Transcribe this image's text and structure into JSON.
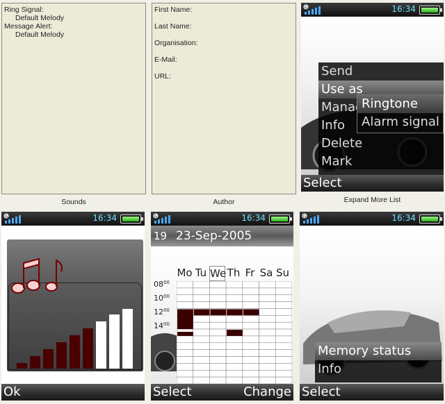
{
  "sounds": {
    "lines": [
      {
        "text": "Ring Signal:",
        "indent": false
      },
      {
        "text": "Default Melody",
        "indent": true
      },
      {
        "text": "Message Alert:",
        "indent": false
      },
      {
        "text": "Default Melody",
        "indent": true
      }
    ],
    "caption": "Sounds"
  },
  "author": {
    "fields": [
      "First Name:",
      "Last Name:",
      "Organisation:",
      "E-Mail:",
      "URL:"
    ],
    "caption": "Author"
  },
  "expand": {
    "caption": "Expand More List",
    "time": "16:34",
    "menu": [
      "Send",
      "Use as",
      "Manage",
      "Info",
      "Delete",
      "Mark"
    ],
    "submenu": [
      "Ringtone",
      "Alarm signal"
    ],
    "soft_left": "Select"
  },
  "volume": {
    "time": "16:34",
    "soft_left": "Ok",
    "note_icon": "music-note-icon",
    "level_filled": 6,
    "level_total": 9
  },
  "calendar": {
    "time": "16:34",
    "week": "19",
    "date": "23-Sep-2005",
    "days": [
      "Mo",
      "Tu",
      "We",
      "Th",
      "Fr",
      "Sa",
      "Su"
    ],
    "hours": [
      "08",
      "10",
      "12",
      "14"
    ],
    "minutes": "00",
    "soft_left": "Select",
    "soft_right": "Change"
  },
  "memory": {
    "time": "16:34",
    "menu": [
      "Memory status",
      "Info"
    ],
    "soft_left": "Select"
  },
  "colors": {
    "accent": "#6fe0ff",
    "battery": "#2bb31a",
    "busy": "#3a0000"
  }
}
